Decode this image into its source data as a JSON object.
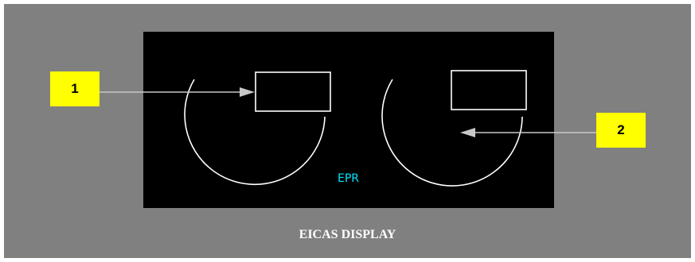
{
  "display": {
    "title": "EICAS DISPLAY",
    "gauge_label": "EPR"
  },
  "callouts": [
    {
      "number": "1"
    },
    {
      "number": "2"
    }
  ],
  "colors": {
    "background": "#808080",
    "screen": "#000000",
    "callout_fill": "#ffff00",
    "gauge_label": "#00e5ff",
    "gauge_stroke": "#ffffff",
    "arrow": "#c8c8c8"
  }
}
